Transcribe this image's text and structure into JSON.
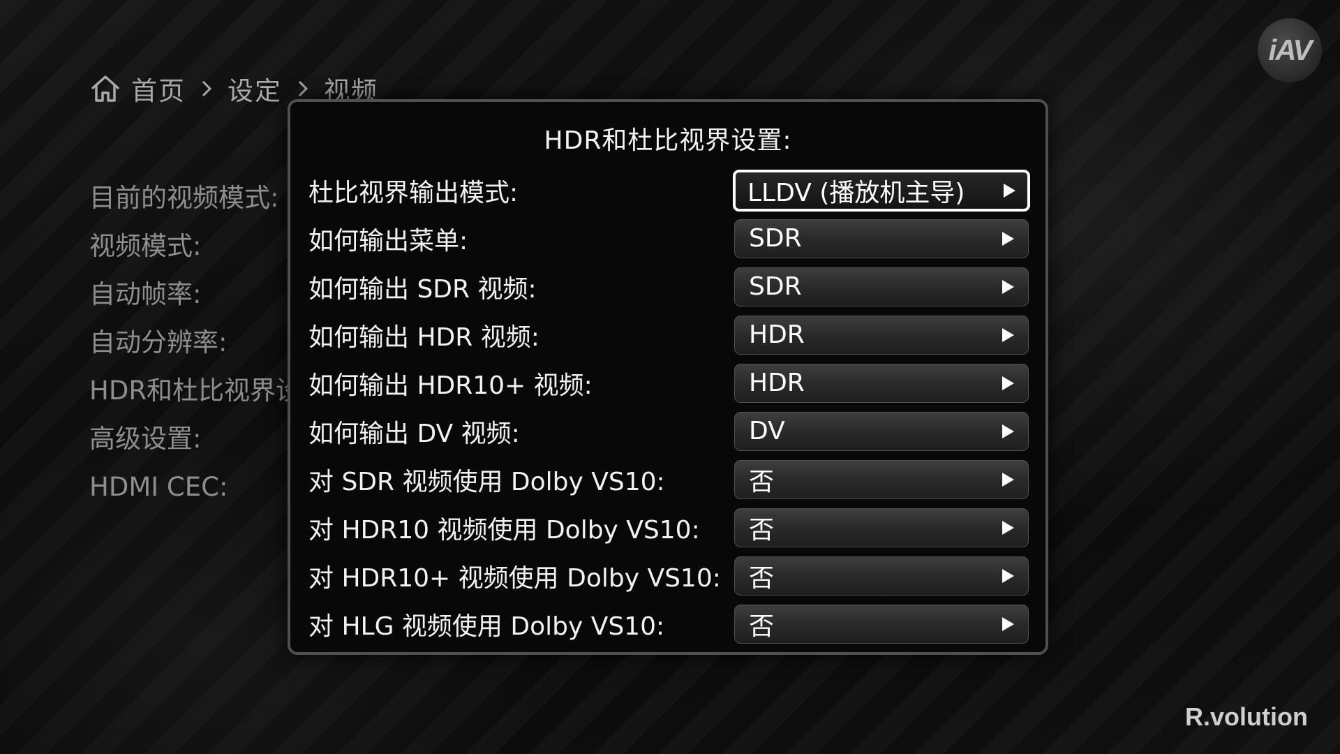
{
  "breadcrumb": {
    "items": [
      "首页",
      "设定",
      "视频"
    ]
  },
  "left_menu": {
    "items": [
      "目前的视频模式:",
      "视频模式:",
      "自动帧率:",
      "自动分辨率:",
      "HDR和杜比视界设置:",
      "高级设置:",
      "HDMI CEC:"
    ]
  },
  "logo": {
    "text": "iAV"
  },
  "brand": {
    "text": "R.volution"
  },
  "dialog": {
    "title": "HDR和杜比视界设置:",
    "rows": [
      {
        "label": "杜比视界输出模式:",
        "value": "LLDV (播放机主导)",
        "selected": true
      },
      {
        "label": "如何输出菜单:",
        "value": "SDR"
      },
      {
        "label": "如何输出 SDR 视频:",
        "value": "SDR"
      },
      {
        "label": "如何输出 HDR 视频:",
        "value": "HDR"
      },
      {
        "label": "如何输出 HDR10+ 视频:",
        "value": "HDR"
      },
      {
        "label": "如何输出 DV 视频:",
        "value": "DV"
      },
      {
        "label": "对 SDR 视频使用 Dolby VS10:",
        "value": "否"
      },
      {
        "label": "对 HDR10 视频使用 Dolby VS10:",
        "value": "否"
      },
      {
        "label": "对 HDR10+ 视频使用 Dolby VS10:",
        "value": "否"
      },
      {
        "label": "对 HLG 视频使用 Dolby VS10:",
        "value": "否"
      }
    ]
  },
  "icons": {
    "home": "home-icon",
    "separator": "chevron-right-icon",
    "option_arrow": "play-arrow-icon"
  },
  "colors": {
    "background": "#0b0b0b",
    "dialog_border": "#4f4f4f",
    "selected_border": "#ffffff",
    "dim_text": "#8e8e8e"
  }
}
